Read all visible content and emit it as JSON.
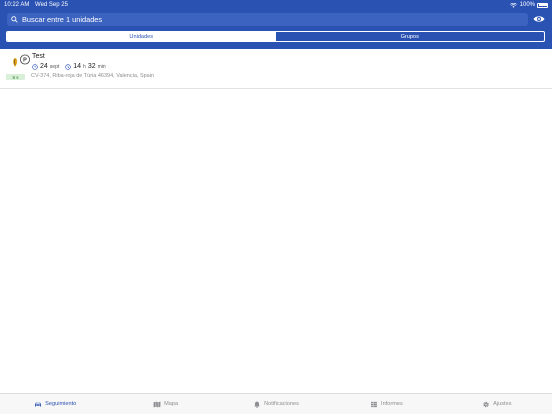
{
  "status_bar": {
    "time": "10:22 AM",
    "date": "Wed Sep 25",
    "battery": "100%"
  },
  "search": {
    "placeholder": "Buscar entre 1 unidades"
  },
  "segments": [
    {
      "label": "Unidades",
      "active": true
    },
    {
      "label": "Grupos",
      "active": false
    }
  ],
  "unit": {
    "name": "Test",
    "day": "24",
    "month": "sept",
    "hours": "14",
    "hours_unit": "h",
    "minutes": "32",
    "minutes_unit": "min",
    "address": "CV-374, Riba-roja de Túria 46394, Valencia, Spain",
    "age": "8 s"
  },
  "tabs": [
    {
      "label": "Seguimiento",
      "icon": "car-icon",
      "active": true
    },
    {
      "label": "Mapa",
      "icon": "map-icon",
      "active": false
    },
    {
      "label": "Notificaciones",
      "icon": "bell-icon",
      "active": false
    },
    {
      "label": "Informes",
      "icon": "table-icon",
      "active": false
    },
    {
      "label": "Ajustes",
      "icon": "gear-icon",
      "active": false
    }
  ],
  "colors": {
    "brand": "#2a52b3",
    "active_tab": "#2a52b3",
    "inactive_tab": "#8e8e93",
    "age_badge_bg": "#d8efd8"
  }
}
